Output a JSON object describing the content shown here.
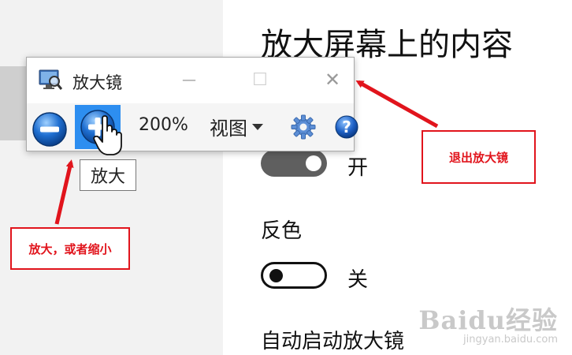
{
  "settings": {
    "page_title": "放大屏幕上的内容",
    "magnifier_toggle_state": "开",
    "invert_colors_label": "反色",
    "invert_colors_state": "关",
    "auto_start_label": "自动启动放大镜"
  },
  "magnifier": {
    "title": "放大镜",
    "minimize_glyph": "—",
    "maximize_glyph": "☐",
    "close_glyph": "✕",
    "zoom_level": "200%",
    "view_label": "视图",
    "help_glyph": "?",
    "tooltip": "放大"
  },
  "annotations": {
    "exit_note": "退出放大镜",
    "zoom_note": "放大，或者缩小"
  },
  "watermark": {
    "main": "Baidu经验",
    "sub": "jingyan.baidu.com"
  },
  "colors": {
    "annotation_red": "#e1141c",
    "zoom_in_highlight": "#2d8ef0",
    "toggle_on": "#5f5f5f",
    "panel_gray": "#f2f2f2"
  }
}
